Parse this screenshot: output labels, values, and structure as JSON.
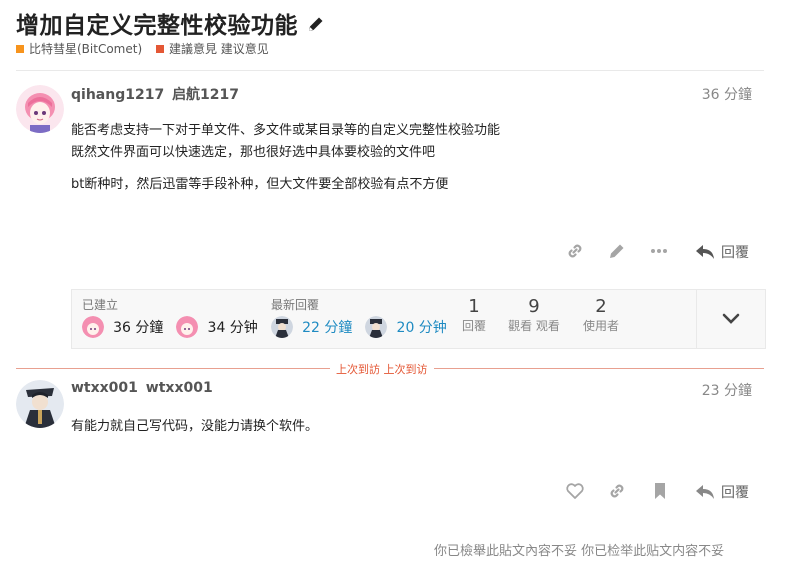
{
  "topic": {
    "title": "增加自定义完整性校验功能",
    "categories": [
      {
        "label": "比特彗星(BitComet)",
        "color": "#f7941d"
      },
      {
        "label": "建議意見 建议意见",
        "color": "#e45735"
      }
    ]
  },
  "posts": [
    {
      "username": "qihang1217",
      "display_name": "启航1217",
      "time": "36 分鐘",
      "lines": [
        "能否考虑支持一下对于单文件、多文件或某目录等的自定义完整性校验功能",
        "既然文件界面可以快速选定，那也很好选中具体要校验的文件吧"
      ],
      "paragraph2": "bt断种时，然后迅雷等手段补种，但大文件要全部校验有点不方便"
    },
    {
      "username": "wtxx001",
      "display_name": "wtxx001",
      "time": "23 分鐘",
      "text": "有能力就自己写代码，没能力请换个软件。"
    }
  ],
  "actions": {
    "reply_label": "回覆",
    "icons": [
      "link-icon",
      "edit-icon",
      "more-icon",
      "reply-icon",
      "heart-icon",
      "bookmark-icon",
      "chevron-down-icon",
      "pencil-icon"
    ]
  },
  "topic_map": {
    "created_label": "已建立",
    "created_time_1": "36 分鐘",
    "created_time_2": "34 分钟",
    "last_reply_label": "最新回覆",
    "last_reply_time_1": "22 分鐘",
    "last_reply_time_2": "20 分钟",
    "stats": [
      {
        "num": "1",
        "label": "回覆"
      },
      {
        "num": "9",
        "label": "觀看 观看"
      },
      {
        "num": "2",
        "label": "使用者"
      }
    ]
  },
  "last_visit_label": "上次到訪 上次到访",
  "flagged_notice": "你已檢舉此貼文內容不妥 你已检举此贴文内容不妥",
  "colors": {
    "accent": "#e45735",
    "link_blue": "#1f8bc2"
  }
}
